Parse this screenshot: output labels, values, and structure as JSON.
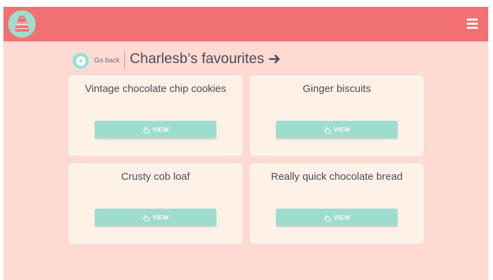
{
  "header": {
    "logo_icon": "cake-icon",
    "menu_icon": "hamburger-menu-icon",
    "background_color": "#f07074"
  },
  "title_bar": {
    "back_label": "Go back",
    "back_icon": "arrow-left-icon",
    "title": "Charlesb’s favourites",
    "title_icon": "arrow-right-icon"
  },
  "recipes": [
    {
      "title": "Vintage chocolate chip cookies",
      "button_label": "VIEW"
    },
    {
      "title": "Ginger biscuits",
      "button_label": "VIEW"
    },
    {
      "title": "Crusty cob loaf",
      "button_label": "VIEW"
    },
    {
      "title": "Really quick chocolate bread",
      "button_label": "VIEW"
    }
  ],
  "colors": {
    "page_background": "#ffdad2",
    "accent": "#9edccd",
    "card_background": "#fdf1e8"
  }
}
